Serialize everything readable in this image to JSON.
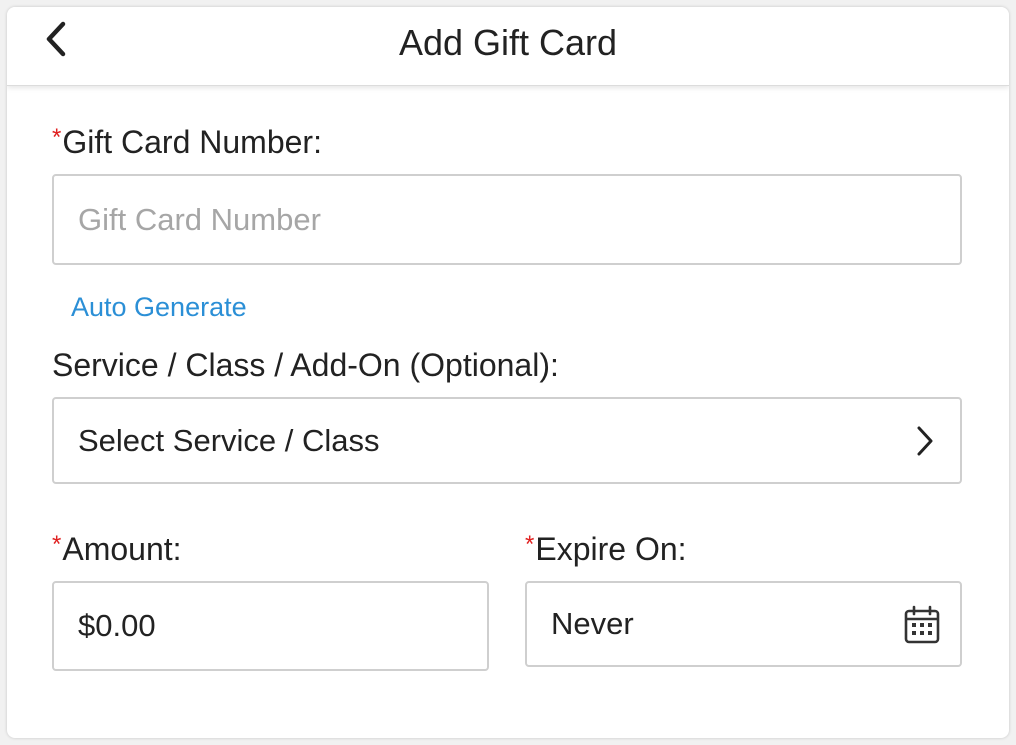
{
  "header": {
    "title": "Add Gift Card",
    "back_icon": "chevron-left-icon"
  },
  "form": {
    "gift_card_number": {
      "required_mark": "*",
      "label": "Gift Card Number:",
      "placeholder": "Gift Card Number",
      "value": ""
    },
    "auto_generate_label": "Auto Generate",
    "service": {
      "label": "Service / Class / Add-On (Optional):",
      "value": "Select Service / Class",
      "icon": "chevron-right-icon"
    },
    "amount": {
      "required_mark": "*",
      "label": "Amount:",
      "value": "$0.00"
    },
    "expire_on": {
      "required_mark": "*",
      "label": "Expire On:",
      "value": "Never",
      "icon": "calendar-icon"
    }
  },
  "colors": {
    "required": "#e02020",
    "link": "#2b8fd6",
    "border": "#cfcfcf",
    "placeholder": "#a6a6a6"
  }
}
